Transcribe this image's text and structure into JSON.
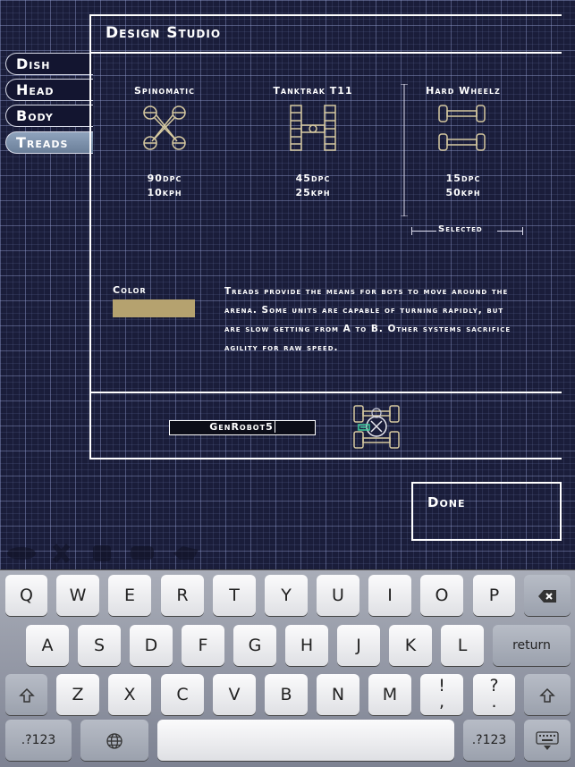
{
  "title": "Design Studio",
  "tabs": [
    {
      "label": "Dish"
    },
    {
      "label": "Head"
    },
    {
      "label": "Body"
    },
    {
      "label": "Treads"
    }
  ],
  "active_tab": "Treads",
  "treads": [
    {
      "name": "Spinomatic",
      "damage": "90dpc",
      "speed": "10kph"
    },
    {
      "name": "Tanktrak T11",
      "damage": "45dpc",
      "speed": "25kph"
    },
    {
      "name": "Hard Wheelz",
      "damage": "15dpc",
      "speed": "50kph"
    }
  ],
  "selected_label": "Selected",
  "selected_tread": "Hard Wheelz",
  "color_label": "Color",
  "color_value": "#b5a26f",
  "description": "Treads provide the means for bots to move around the arena. Some units are capable of turning rapidly, but are slow getting from A to B. Other systems sacrifice agility for raw speed.",
  "robot_name": "GenRobot5",
  "done_label": "Done",
  "keyboard": {
    "row1": [
      "Q",
      "W",
      "E",
      "R",
      "T",
      "Y",
      "U",
      "I",
      "O",
      "P"
    ],
    "backspace_icon": "backspace-icon",
    "row2": [
      "A",
      "S",
      "D",
      "F",
      "G",
      "H",
      "J",
      "K",
      "L"
    ],
    "return_label": "return",
    "shift_icon": "shift-icon",
    "row3": [
      "Z",
      "X",
      "C",
      "V",
      "B",
      "N",
      "M"
    ],
    "row3_punct": [
      {
        "top": "!",
        "bottom": ","
      },
      {
        "top": "?",
        "bottom": "."
      }
    ],
    "numbers_label": ".?123",
    "globe_icon": "globe-icon",
    "hide_keyboard_icon": "keyboard-hide-icon"
  }
}
